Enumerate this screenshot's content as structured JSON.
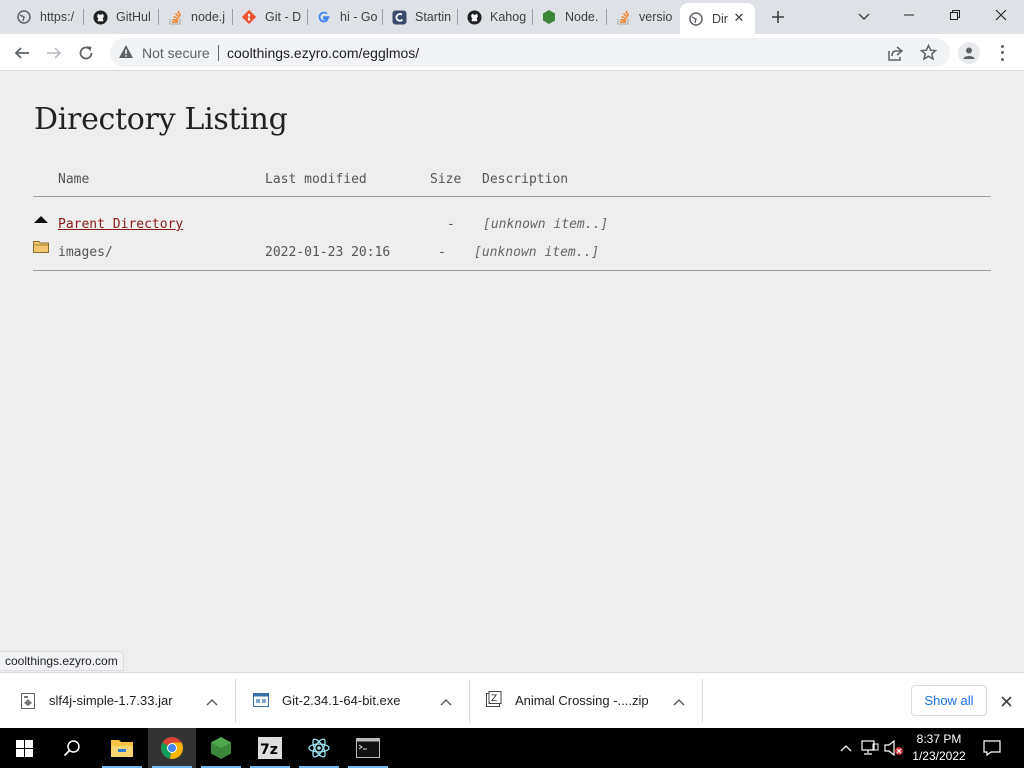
{
  "browser": {
    "tabs": [
      {
        "title": "https:/",
        "icon": "globe-icon"
      },
      {
        "title": "GitHul",
        "icon": "github-icon"
      },
      {
        "title": "node.j",
        "icon": "stackoverflow-icon"
      },
      {
        "title": "Git - D",
        "icon": "git-icon"
      },
      {
        "title": "hi - Go",
        "icon": "google-icon"
      },
      {
        "title": "Startin",
        "icon": "app-icon"
      },
      {
        "title": "Kahog",
        "icon": "github-icon"
      },
      {
        "title": "Node.",
        "icon": "nodejs-icon"
      },
      {
        "title": "versio",
        "icon": "stackoverflow-icon"
      },
      {
        "title": "Dir",
        "icon": "globe-icon",
        "active": true
      }
    ],
    "omnibox": {
      "security_label": "Not secure",
      "url": "coolthings.ezyro.com/egglmos/"
    },
    "status_bubble": "coolthings.ezyro.com"
  },
  "page": {
    "title": "Directory Listing",
    "columns": {
      "name": "Name",
      "last_modified": "Last modified",
      "size": "Size",
      "description": "Description"
    },
    "rows": [
      {
        "icon": "back-arrow-icon",
        "name": "Parent Directory",
        "last_modified": "",
        "size": "-",
        "description": "[unknown item..]",
        "is_link": true
      },
      {
        "icon": "folder-icon",
        "name": "images/",
        "last_modified": "2022-01-23 20:16",
        "size": "-",
        "description": "[unknown item..]",
        "is_link": false
      }
    ]
  },
  "downloads": {
    "items": [
      {
        "name": "slf4j-simple-1.7.33.jar",
        "icon": "jar-file-icon"
      },
      {
        "name": "Git-2.34.1-64-bit.exe",
        "icon": "exe-file-icon"
      },
      {
        "name": "Animal Crossing -....zip",
        "icon": "zip-file-icon"
      }
    ],
    "show_all_label": "Show all"
  },
  "taskbar": {
    "time": "8:37 PM",
    "date": "1/23/2022",
    "apps": [
      "file-explorer-icon",
      "chrome-icon",
      "nodejs-icon",
      "7zip-icon",
      "electron-icon",
      "terminal-icon"
    ]
  },
  "colors": {
    "accent": "#1a73e8",
    "link": "#8b1a1a",
    "taskbar": "#000000"
  }
}
